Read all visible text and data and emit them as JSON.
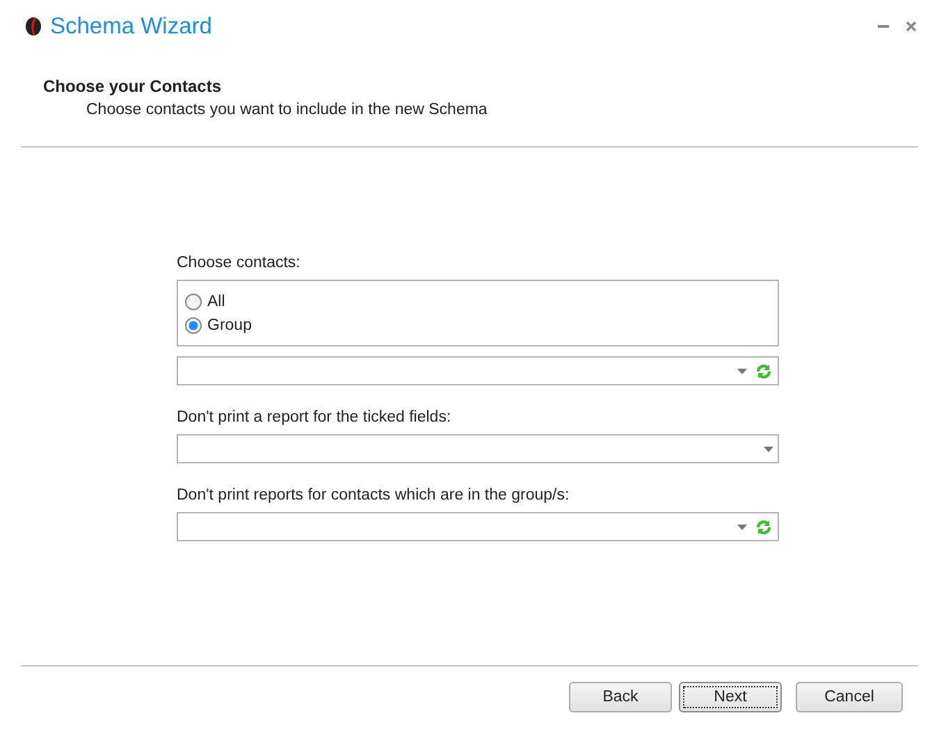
{
  "window": {
    "title": "Schema Wizard"
  },
  "header": {
    "title": "Choose your Contacts",
    "subtitle": "Choose contacts you want to include in the new Schema"
  },
  "form": [
    {
      "kind": "radios",
      "label": "Choose contacts:",
      "options": [
        {
          "label": "All",
          "selected": false
        },
        {
          "label": "Group",
          "selected": true
        }
      ]
    },
    {
      "kind": "combo",
      "refresh": true
    },
    {
      "kind": "label",
      "label": "Don't print a report for the ticked fields:"
    },
    {
      "kind": "combo",
      "refresh": false
    },
    {
      "kind": "label",
      "label": "Don't print reports for contacts which are in the group/s:"
    },
    {
      "kind": "combo",
      "refresh": true
    }
  ],
  "buttons": [
    {
      "label": "Back",
      "focused": false
    },
    {
      "label": "Next",
      "focused": true
    },
    {
      "label": "Cancel",
      "focused": false
    }
  ]
}
